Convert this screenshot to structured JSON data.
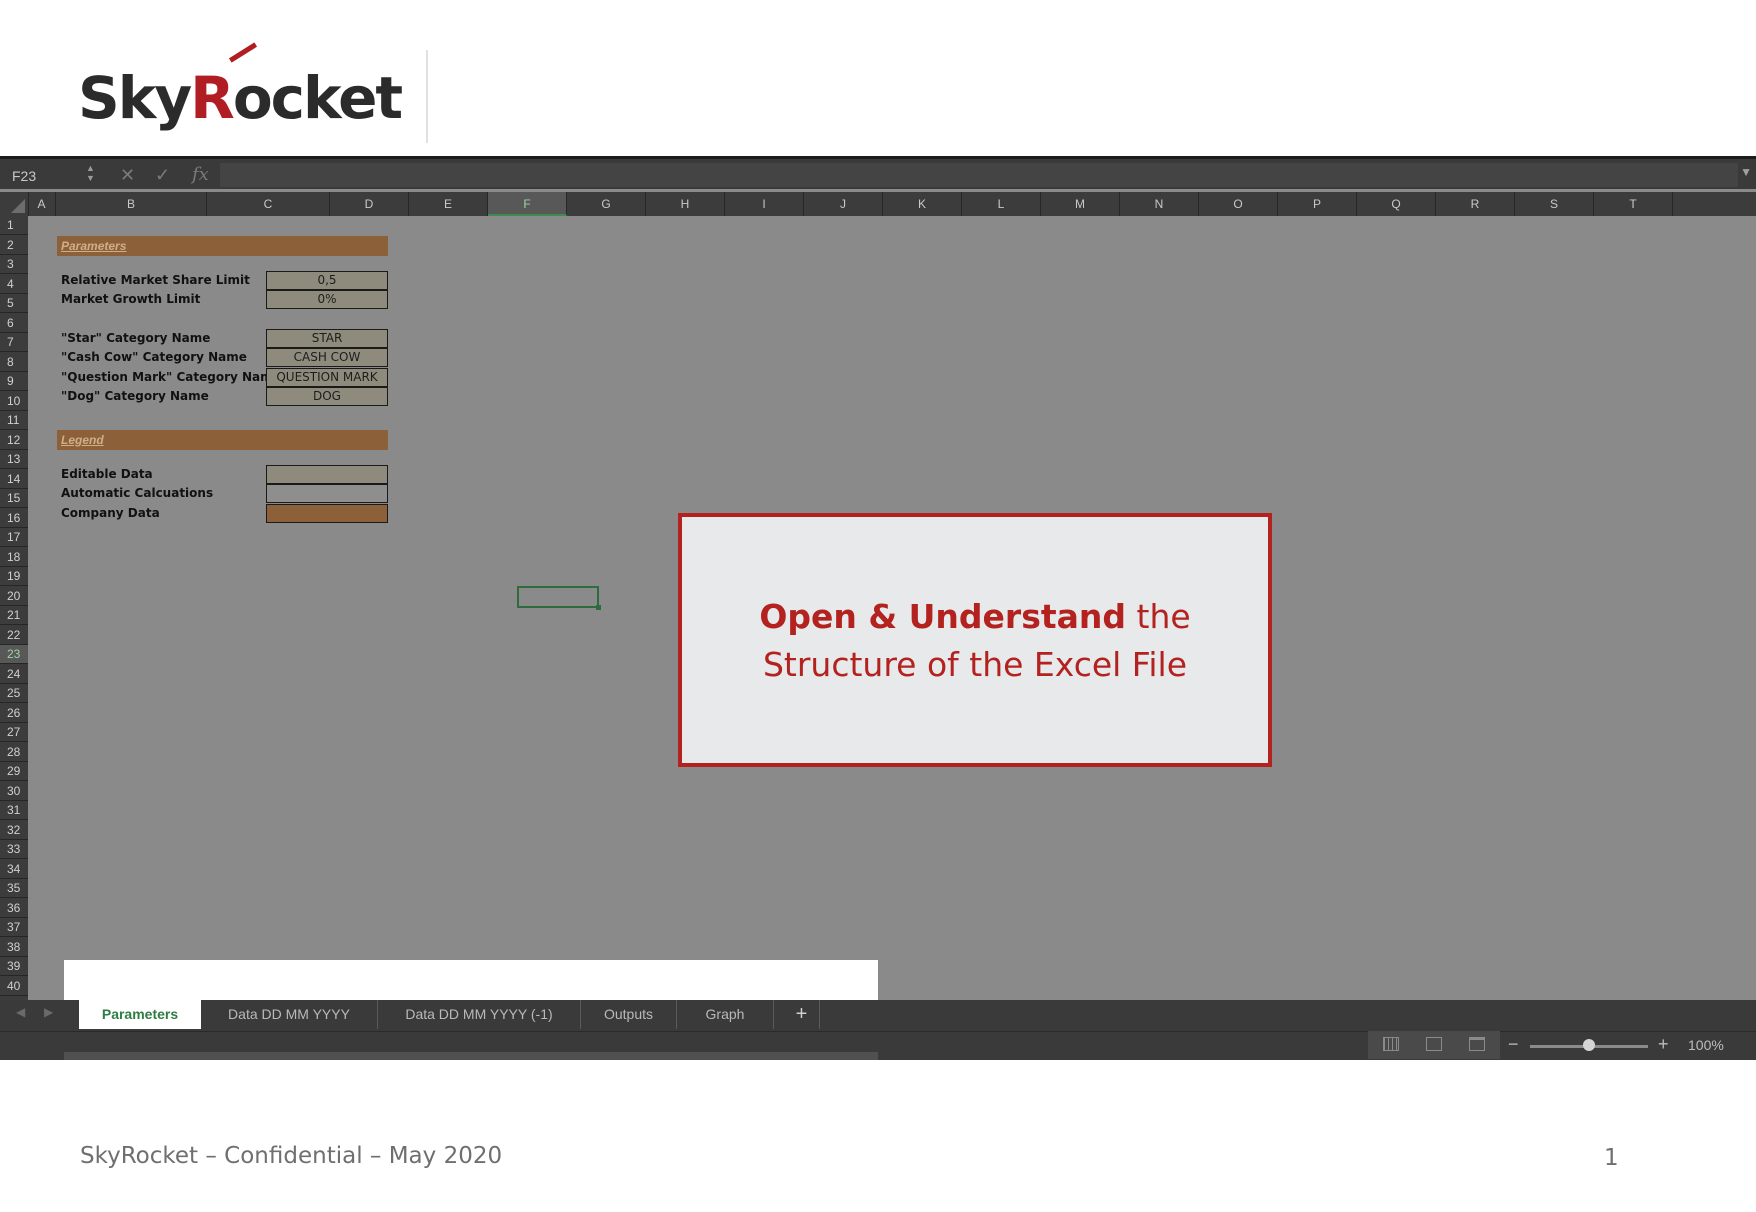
{
  "brand": {
    "logo_prefix": "Sky",
    "logo_r": "R",
    "logo_suffix": "ocket",
    "accent_color": "#b01e23"
  },
  "formula_bar": {
    "name_box": "F23",
    "cancel_icon": "✕",
    "confirm_icon": "✓",
    "fx_label": "fx",
    "value": ""
  },
  "columns": [
    "A",
    "B",
    "C",
    "D",
    "E",
    "F",
    "G",
    "H",
    "I",
    "J",
    "K",
    "L",
    "M",
    "N",
    "O",
    "P",
    "Q",
    "R",
    "S",
    "T"
  ],
  "selected_column": "F",
  "rows": [
    "1",
    "2",
    "3",
    "4",
    "5",
    "6",
    "7",
    "8",
    "9",
    "10",
    "11",
    "12",
    "13",
    "14",
    "15",
    "16",
    "17",
    "18",
    "19",
    "20",
    "21",
    "22",
    "23",
    "24",
    "25",
    "26",
    "27",
    "28",
    "29",
    "30",
    "31",
    "32",
    "33",
    "34",
    "35",
    "36",
    "37",
    "38",
    "39",
    "40"
  ],
  "selected_row": "23",
  "sheet": {
    "parameters_header": "Parameters",
    "relative_market_share": {
      "label": "Relative Market Share Limit",
      "value": "0,5"
    },
    "market_growth": {
      "label": "Market Growth Limit",
      "value": "0%"
    },
    "star": {
      "label": "\"Star\" Category Name",
      "value": "STAR"
    },
    "cash_cow": {
      "label": "\"Cash Cow\" Category Name",
      "value": "CASH COW"
    },
    "question_mark": {
      "label": "\"Question Mark\" Category Name",
      "value": "QUESTION MARK"
    },
    "dog": {
      "label": "\"Dog\" Category Name",
      "value": "DOG"
    },
    "legend_header": "Legend",
    "editable": {
      "label": "Editable Data"
    },
    "automatic": {
      "label": "Automatic Calcuations"
    },
    "company": {
      "label": "Company Data"
    }
  },
  "callout": {
    "bold_part": "Open & Understand",
    "rest_line1": " the",
    "line2": "Structure of the Excel File"
  },
  "tabs": {
    "active": "Parameters",
    "items": [
      "Parameters",
      "Data DD MM YYYY",
      "Data DD MM YYYY (-1)",
      "Outputs",
      "Graph"
    ],
    "add_label": "+"
  },
  "status": {
    "zoom_minus": "−",
    "zoom_plus": "+",
    "zoom_level": "100%",
    "zoom_fraction": 0.5
  },
  "footer": {
    "text": "SkyRocket – Confidential – May 2020",
    "page_number": "1"
  }
}
